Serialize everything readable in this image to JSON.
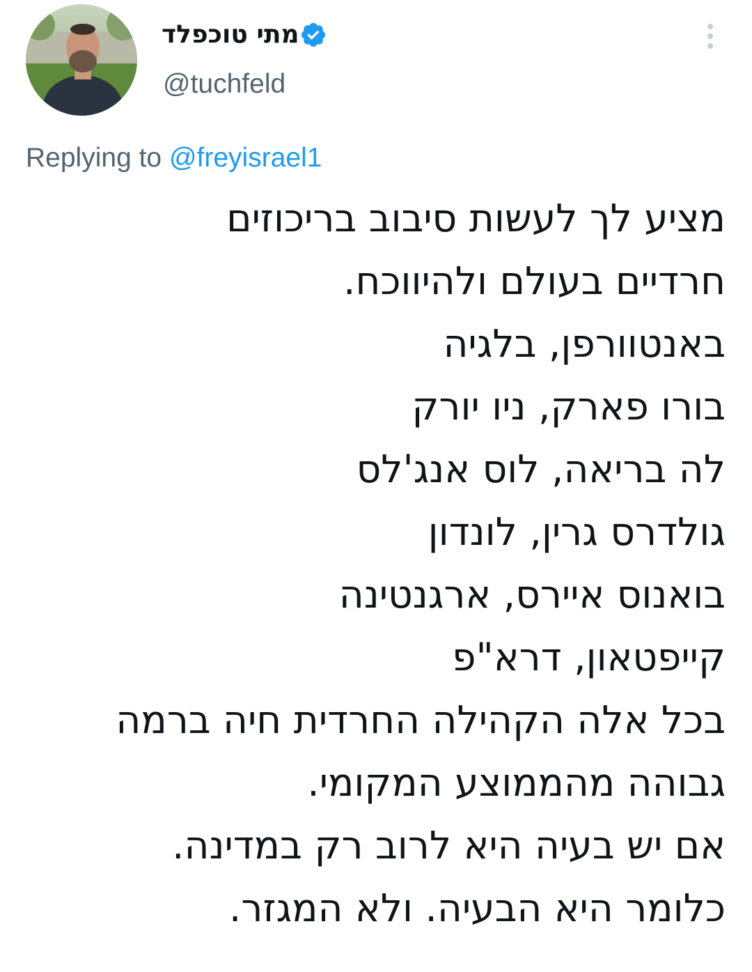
{
  "author": {
    "display_name": "מתי טוכפלד",
    "handle": "@tuchfeld",
    "verified": true
  },
  "reply": {
    "prefix": "Replying to ",
    "mention": "@freyisrael1"
  },
  "tweet": {
    "lines": [
      "מציע לך לעשות סיבוב בריכוזים",
      "חרדיים בעולם ולהיווכח.",
      "באנטוורפן, בלגיה",
      "בורו פארק, ניו יורק",
      "לה בריאה, לוס אנג'לס",
      "גולדרס גרין, לונדון",
      "בואנוס איירס, ארגנטינה",
      "קייפטאון, דרא\"פ",
      "בכל אלה הקהילה החרדית חיה ברמה",
      "גבוהה מהממוצע המקומי.",
      "אם יש בעיה היא לרוב רק במדינה.",
      "כלומר היא הבעיה. ולא המגזר."
    ]
  },
  "icons": {
    "verified": "verified-badge-icon",
    "more": "more-vertical-icon"
  },
  "colors": {
    "accent": "#1d9bf0",
    "text_primary": "#0f1419",
    "text_secondary": "#536471",
    "background": "#ffffff"
  }
}
